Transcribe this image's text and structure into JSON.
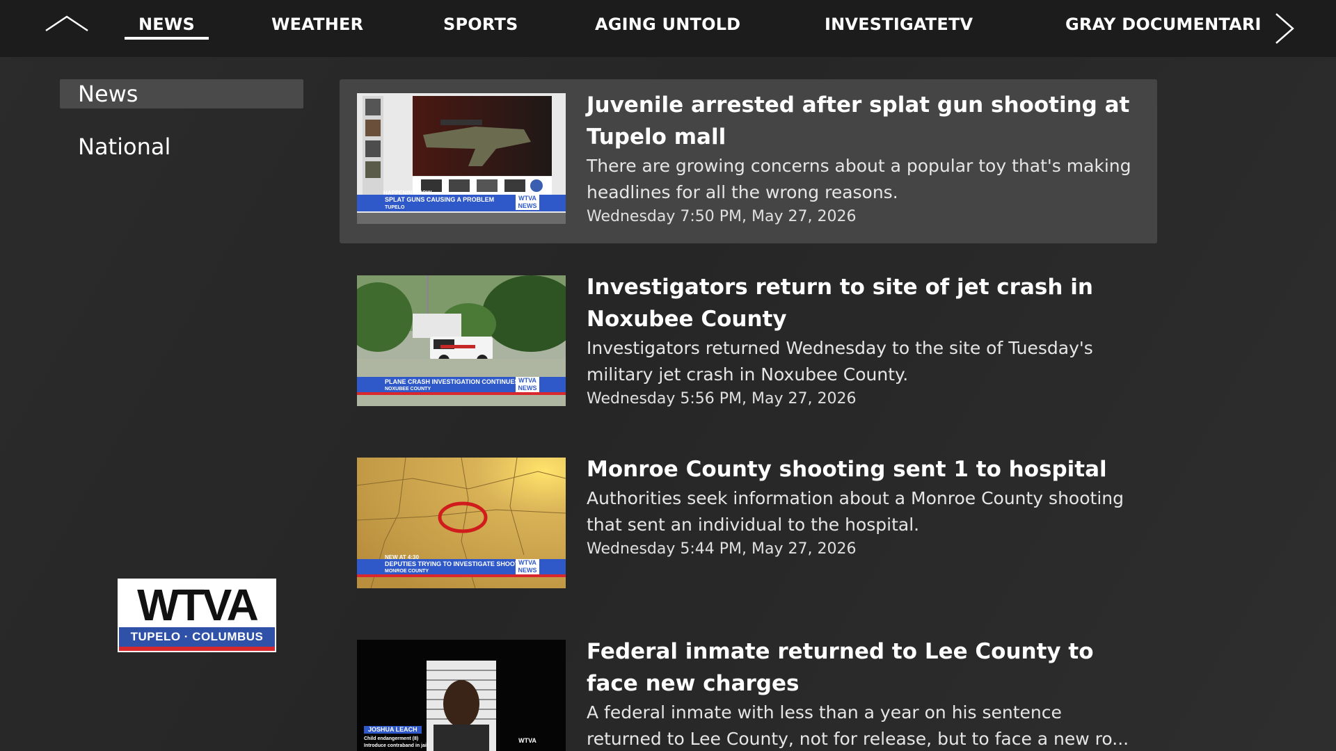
{
  "nav": {
    "tabs": [
      {
        "label": "NEWS",
        "active": true
      },
      {
        "label": "WEATHER",
        "active": false
      },
      {
        "label": "SPORTS",
        "active": false
      },
      {
        "label": "AGING UNTOLD",
        "active": false
      },
      {
        "label": "INVESTIGATETV",
        "active": false
      },
      {
        "label": "GRAY DOCUMENTARIES",
        "active": false
      }
    ],
    "up_icon": "chevron-up-icon",
    "next_icon": "chevron-right-icon"
  },
  "sidebar": {
    "items": [
      {
        "label": "News",
        "selected": true
      },
      {
        "label": "National",
        "selected": false
      }
    ]
  },
  "logo": {
    "word": "WTVA",
    "tagline": "TUPELO · COLUMBUS"
  },
  "stories": [
    {
      "headline": "Juvenile arrested after splat gun shooting at Tupelo mall",
      "summary": "There are growing concerns about a popular toy that's making headlines for all the wrong reasons.",
      "date": "Wednesday 7:50 PM, May 27, 2026",
      "thumb_chyron": "SPLAT GUNS CAUSING A PROBLEM",
      "thumb_chyron_sub": "TUPELO",
      "thumb_tag": "HAPPENING NOW",
      "selected": true
    },
    {
      "headline": "Investigators return to site of jet crash in Noxubee County",
      "summary": "Investigators returned Wednesday to the site of Tuesday's military jet crash in Noxubee County.",
      "date": "Wednesday 5:56 PM, May 27, 2026",
      "thumb_chyron": "PLANE CRASH INVESTIGATION CONTINUES",
      "thumb_chyron_sub": "NOXUBEE COUNTY",
      "selected": false
    },
    {
      "headline": "Monroe County shooting sent 1 to hospital",
      "summary": "Authorities seek information about a Monroe County shooting that sent an individual to the hospital.",
      "date": "Wednesday 5:44 PM, May 27, 2026",
      "thumb_chyron": "DEPUTIES TRYING TO INVESTIGATE SHOOTING",
      "thumb_chyron_sub": "MONROE COUNTY",
      "thumb_tag": "NEW AT 4:30",
      "selected": false
    },
    {
      "headline": "Federal inmate returned to Lee County to face new charges",
      "summary": "A federal inmate with less than a year on his sentence returned to Lee County, not for release, but to face a new ro...",
      "date": "",
      "thumb_chyron": "JOSHUA LEACH",
      "thumb_chyron_sub": "Child endangerment (8)",
      "thumb_chyron_sub2": "Introduce contraband in jail",
      "selected": false
    }
  ],
  "thumb_logo": "WTVA",
  "thumb_logo_sub": "NEWS",
  "colors": {
    "nav_bg": "#1c1c1c",
    "page_bg": "#2b2b2b",
    "selected_row": "#454545",
    "accent_blue": "#2f59c8",
    "accent_red": "#d8282e"
  }
}
